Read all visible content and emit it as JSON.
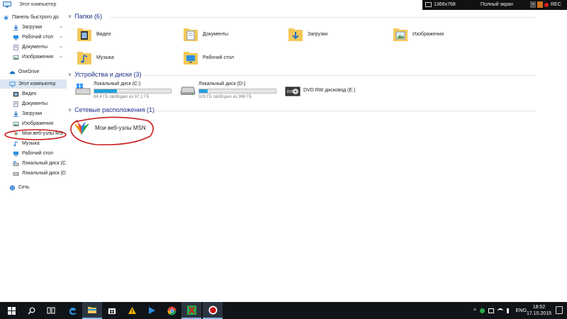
{
  "window": {
    "title": "Этот компьютер"
  },
  "recorder": {
    "resolution": "1366x768",
    "mode": "Полный экран",
    "minus": "−",
    "rec_label": "REC"
  },
  "nav": {
    "items": [
      {
        "label": "Панель быстрого до",
        "pinned": false
      },
      {
        "label": "Загрузки",
        "pinned": true
      },
      {
        "label": "Рабочий стол",
        "pinned": true
      },
      {
        "label": "Документы",
        "pinned": true
      },
      {
        "label": "Изображения",
        "pinned": true
      },
      {
        "label": "OneDrive",
        "pinned": false
      },
      {
        "label": "Этот компьютер",
        "pinned": false
      },
      {
        "label": "Видео",
        "pinned": false
      },
      {
        "label": "Документы",
        "pinned": false
      },
      {
        "label": "Загрузки",
        "pinned": false
      },
      {
        "label": "Изображения",
        "pinned": false
      },
      {
        "label": "Мои веб-узлы MS",
        "pinned": false
      },
      {
        "label": "Музыка",
        "pinned": false
      },
      {
        "label": "Рабочий стол",
        "pinned": false
      },
      {
        "label": "Локальный диск (C",
        "pinned": false
      },
      {
        "label": "Локальный диск (D",
        "pinned": false
      },
      {
        "label": "Сеть",
        "pinned": false
      }
    ],
    "pin_glyph": "⊸"
  },
  "groups": {
    "folders": {
      "title": "Папки (6)",
      "chevron": "∨"
    },
    "devices": {
      "title": "Устройства и диски (3)",
      "chevron": "∨"
    },
    "network": {
      "title": "Сетевые расположения (1)",
      "chevron": "∨"
    }
  },
  "folders": [
    {
      "label": "Видео",
      "icon": "video-folder-icon"
    },
    {
      "label": "Документы",
      "icon": "documents-folder-icon"
    },
    {
      "label": "Загрузки",
      "icon": "downloads-folder-icon"
    },
    {
      "label": "Изображения",
      "icon": "pictures-folder-icon"
    },
    {
      "label": "Музыка",
      "icon": "music-folder-icon"
    },
    {
      "label": "Рабочий стол",
      "icon": "desktop-folder-icon"
    }
  ],
  "drives": [
    {
      "name": "Локальный диск (C:)",
      "free": "68,4 ГБ свободно из 97,1 ГБ",
      "used_fraction": 0.3
    },
    {
      "name": "Локальный диск (D:)",
      "free": "329 ГБ свободно из 368 ГБ",
      "used_fraction": 0.11
    },
    {
      "name": "DVD RW дисковод (E:)",
      "dvd_label": "DVD"
    }
  ],
  "network_locations": [
    {
      "label": "Мои веб-узлы MSN",
      "icon": "msn-butterfly-icon"
    }
  ],
  "taskbar": {
    "lang": "ENG",
    "time": "18:52",
    "date": "17.10.2015"
  },
  "colors": {
    "accent": "#26a0da",
    "selected": "#dbe6f2",
    "taskbar": "#101418",
    "annotation": "#c81e1e",
    "group_header": "#1e3287"
  }
}
